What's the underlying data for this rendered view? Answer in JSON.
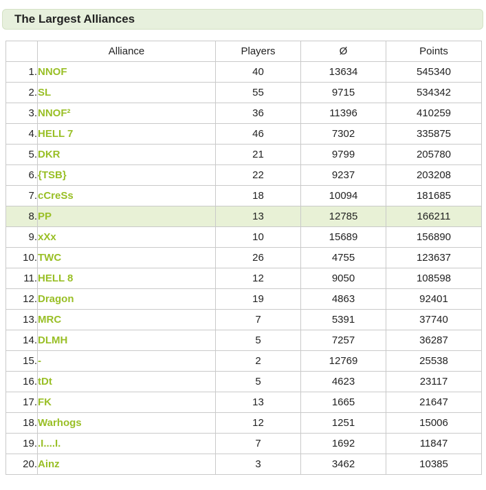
{
  "title": "The Largest Alliances",
  "columns": {
    "rank": "",
    "alliance": "Alliance",
    "players": "Players",
    "average": "Ø",
    "points": "Points"
  },
  "highlight_color": "#e8f1d6",
  "link_color": "#99bf26",
  "rows": [
    {
      "rank": "1.",
      "alliance": "NNOF",
      "players": "40",
      "average": "13634",
      "points": "545340",
      "highlighted": false
    },
    {
      "rank": "2.",
      "alliance": "SL",
      "players": "55",
      "average": "9715",
      "points": "534342",
      "highlighted": false
    },
    {
      "rank": "3.",
      "alliance": "NNOF²",
      "players": "36",
      "average": "11396",
      "points": "410259",
      "highlighted": false
    },
    {
      "rank": "4.",
      "alliance": "HELL 7",
      "players": "46",
      "average": "7302",
      "points": "335875",
      "highlighted": false
    },
    {
      "rank": "5.",
      "alliance": "DKR",
      "players": "21",
      "average": "9799",
      "points": "205780",
      "highlighted": false
    },
    {
      "rank": "6.",
      "alliance": "{TSB}",
      "players": "22",
      "average": "9237",
      "points": "203208",
      "highlighted": false
    },
    {
      "rank": "7.",
      "alliance": "cCreSs",
      "players": "18",
      "average": "10094",
      "points": "181685",
      "highlighted": false
    },
    {
      "rank": "8.",
      "alliance": "PP",
      "players": "13",
      "average": "12785",
      "points": "166211",
      "highlighted": true
    },
    {
      "rank": "9.",
      "alliance": "xXx",
      "players": "10",
      "average": "15689",
      "points": "156890",
      "highlighted": false
    },
    {
      "rank": "10.",
      "alliance": "TWC",
      "players": "26",
      "average": "4755",
      "points": "123637",
      "highlighted": false
    },
    {
      "rank": "11.",
      "alliance": "HELL 8",
      "players": "12",
      "average": "9050",
      "points": "108598",
      "highlighted": false
    },
    {
      "rank": "12.",
      "alliance": "Dragon",
      "players": "19",
      "average": "4863",
      "points": "92401",
      "highlighted": false
    },
    {
      "rank": "13.",
      "alliance": "MRC",
      "players": "7",
      "average": "5391",
      "points": "37740",
      "highlighted": false
    },
    {
      "rank": "14.",
      "alliance": "DLMH",
      "players": "5",
      "average": "7257",
      "points": "36287",
      "highlighted": false
    },
    {
      "rank": "15.",
      "alliance": "-",
      "players": "2",
      "average": "12769",
      "points": "25538",
      "highlighted": false
    },
    {
      "rank": "16.",
      "alliance": "tDt",
      "players": "5",
      "average": "4623",
      "points": "23117",
      "highlighted": false
    },
    {
      "rank": "17.",
      "alliance": "FK",
      "players": "13",
      "average": "1665",
      "points": "21647",
      "highlighted": false
    },
    {
      "rank": "18.",
      "alliance": "Warhogs",
      "players": "12",
      "average": "1251",
      "points": "15006",
      "highlighted": false
    },
    {
      "rank": "19.",
      "alliance": ".I....I.",
      "players": "7",
      "average": "1692",
      "points": "11847",
      "highlighted": false
    },
    {
      "rank": "20.",
      "alliance": "Ainz",
      "players": "3",
      "average": "3462",
      "points": "10385",
      "highlighted": false
    }
  ]
}
